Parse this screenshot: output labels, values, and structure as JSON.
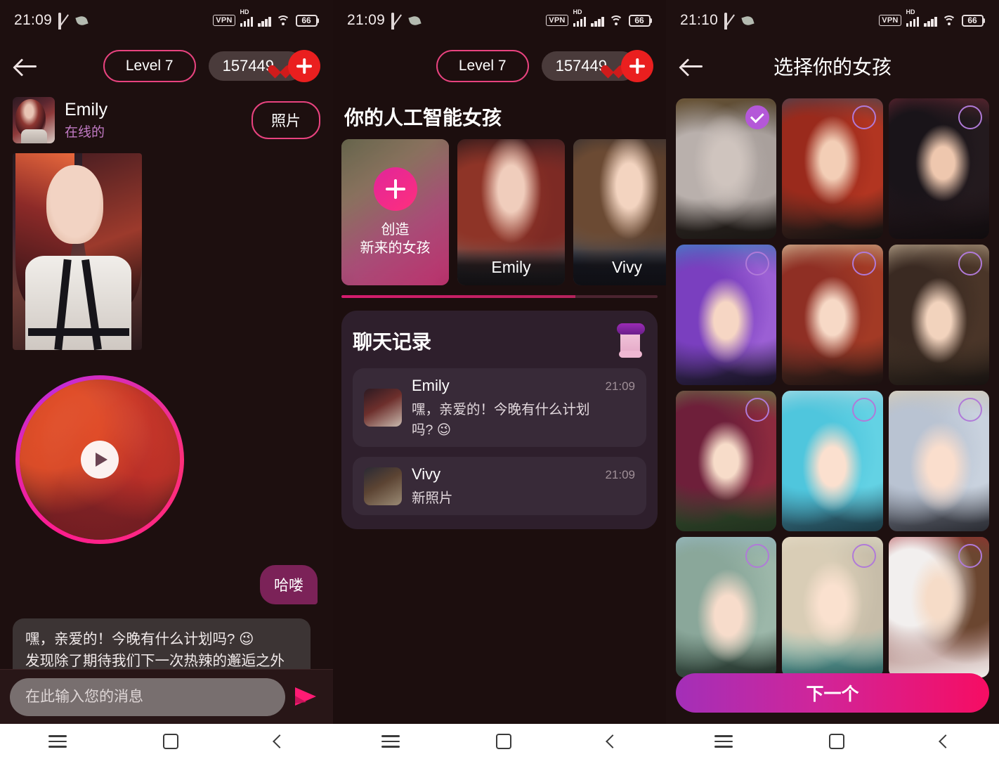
{
  "status_bar": {
    "time_left": "21:09",
    "time_right": "21:10",
    "vpn": "VPN",
    "hd": "HD",
    "battery": "66",
    "icons": [
      "bell-mute-icon",
      "leaf-icon",
      "vpn-badge",
      "signal-hd-icon",
      "signal-icon",
      "wifi-icon",
      "battery-icon"
    ]
  },
  "panel1": {
    "back_icon": "back-arrow-icon",
    "level_label": "Level 7",
    "coins": "157449",
    "coin_icon": "gem-icon",
    "add_icon": "plus-icon",
    "profile": {
      "name": "Emily",
      "status": "在线的",
      "photos_button": "照片",
      "avatar": "emily-avatar"
    },
    "video": {
      "play_icon": "play-icon"
    },
    "messages": [
      {
        "side": "out",
        "text": "哈喽"
      },
      {
        "side": "in",
        "text": "嘿，亲爱的！今晚有什么计划吗? 😉\n发现除了期待我们下一次热辣的邂逅之外不可能专注于任何事情……😋💫"
      }
    ],
    "composer": {
      "placeholder": "在此输入您的消息",
      "value": "",
      "send_icon": "send-icon"
    }
  },
  "panel2": {
    "level_label": "Level 7",
    "coins": "157449",
    "section_title": "你的人工智能女孩",
    "cards": [
      {
        "type": "create",
        "line1": "创造",
        "line2": "新来的女孩",
        "icon": "plus-icon"
      },
      {
        "type": "girl",
        "name": "Emily"
      },
      {
        "type": "girl",
        "name": "Vivy"
      }
    ],
    "history": {
      "title": "聊天记录",
      "icon": "scroll-icon",
      "rows": [
        {
          "name": "Emily",
          "message": "嘿，亲爱的！今晚有什么计划吗? 😉",
          "time": "21:09"
        },
        {
          "name": "Vivy",
          "message": "新照片",
          "time": "21:09"
        }
      ]
    }
  },
  "panel3": {
    "back_icon": "back-arrow-icon",
    "title": "选择你的女孩",
    "next_button": "下一个",
    "girls": [
      {
        "id": "g1",
        "desc": "silver-hair-elf",
        "selected": true
      },
      {
        "id": "g2",
        "desc": "red-hair-woman",
        "selected": false
      },
      {
        "id": "g3",
        "desc": "black-hair-girl",
        "selected": false
      },
      {
        "id": "g4",
        "desc": "purple-hair-girl",
        "selected": false
      },
      {
        "id": "g5",
        "desc": "auburn-hair-girl",
        "selected": false
      },
      {
        "id": "g6",
        "desc": "brown-bob-girl",
        "selected": false
      },
      {
        "id": "g7",
        "desc": "maroon-braid-girl",
        "selected": false
      },
      {
        "id": "g8",
        "desc": "cyan-hair-girl",
        "selected": false
      },
      {
        "id": "g9",
        "desc": "platinum-hair-girl",
        "selected": false
      },
      {
        "id": "g10",
        "desc": "mint-catear-elf",
        "selected": false
      },
      {
        "id": "g11",
        "desc": "blonde-bob-girl",
        "selected": false
      },
      {
        "id": "g12",
        "desc": "christmas-brunette",
        "selected": false
      }
    ]
  },
  "navbar": {
    "menu_icon": "menu-icon",
    "home_icon": "home-icon",
    "back_icon": "back-icon"
  },
  "colors": {
    "accent_pink": "#e8437f",
    "accent_magenta": "#ff1b74",
    "purple": "#b458d8",
    "coin_red": "#ea1f1f",
    "bg": "#1d0f0f"
  }
}
